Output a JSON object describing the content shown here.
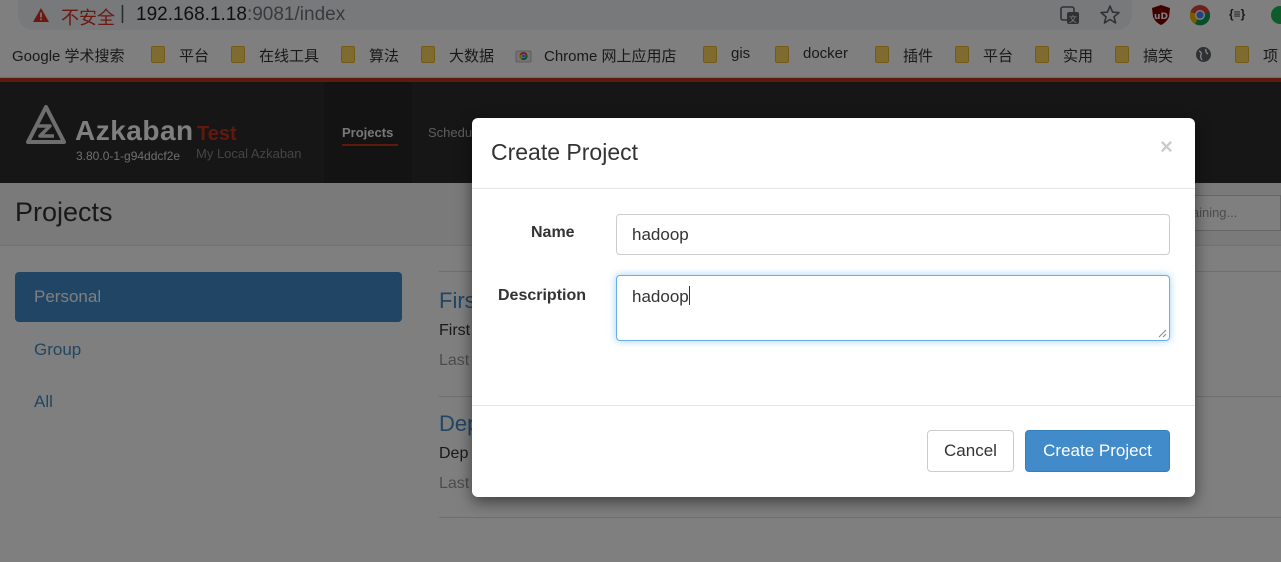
{
  "browser": {
    "security_label": "不安全",
    "separator": "|",
    "url_host": "192.168.1.18",
    "url_rest": ":9081/index",
    "bookmarks": [
      "Google 学术搜索",
      "平台",
      "在线工具",
      "算法",
      "大数据",
      "Chrome 网上应用店",
      "gis",
      "docker",
      "插件",
      "平台",
      "实用",
      "搞笑",
      "项"
    ],
    "ext_json_label": "{≡}"
  },
  "azkaban": {
    "brand": "Azkaban",
    "env_name": "Test",
    "version": "3.80.0-1-g94ddcf2e",
    "env_desc": "My Local Azkaban",
    "nav": {
      "projects": "Projects",
      "schedule": "Schedu"
    },
    "page_title": "Projects",
    "search_placeholder": "ntaining...",
    "sidebar": [
      "Personal",
      "Group",
      "All"
    ],
    "projects": [
      {
        "title": "Firs",
        "desc": "First",
        "last": "Last"
      },
      {
        "title": "Dep",
        "desc": "Dep",
        "last": "Last"
      }
    ]
  },
  "modal": {
    "title": "Create Project",
    "close": "×",
    "name_label": "Name",
    "name_value": "hadoop",
    "desc_label": "Description",
    "desc_value": "hadoop",
    "cancel": "Cancel",
    "create": "Create Project",
    "colors": {
      "primary": "#428bca",
      "danger": "#c2331c"
    }
  }
}
